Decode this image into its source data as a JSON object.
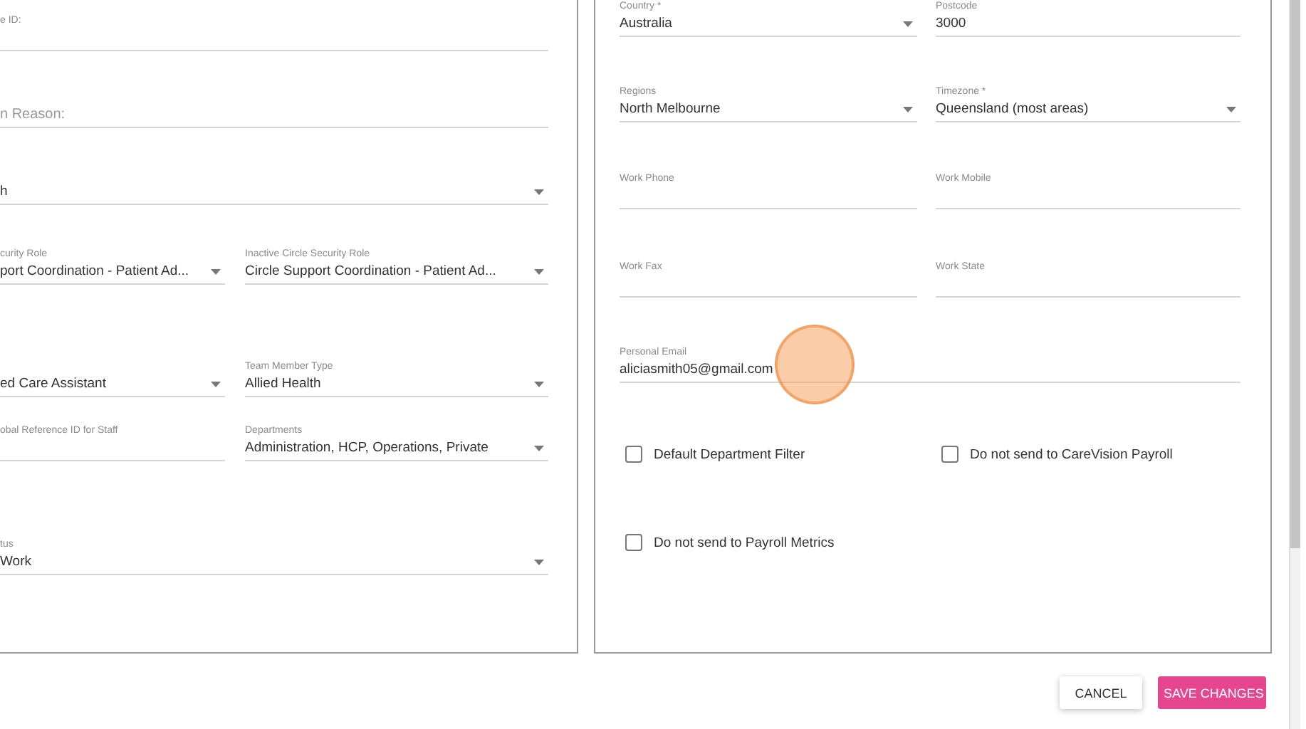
{
  "left_panel": {
    "rows": [
      {
        "fields": [
          {
            "kind": "text",
            "label": "e ID:"
          }
        ]
      },
      {
        "fields": [
          {
            "kind": "text",
            "placeholder": "n Reason:"
          }
        ]
      },
      {
        "fields": [
          {
            "kind": "select",
            "value": "h"
          }
        ]
      },
      {
        "fields": [
          {
            "kind": "select",
            "label": "curity Role",
            "value": "port Coordination - Patient Ad..."
          },
          {
            "kind": "select",
            "label": "Inactive Circle Security Role",
            "value": "Circle Support Coordination - Patient Ad..."
          }
        ]
      },
      {
        "fields": [
          {
            "kind": "select",
            "value": "ed Care Assistant"
          },
          {
            "kind": "select",
            "label": "Team Member Type",
            "value": "Allied Health"
          }
        ]
      },
      {
        "fields": [
          {
            "kind": "text",
            "label": "obal Reference ID for Staff"
          },
          {
            "kind": "select",
            "label": "Departments",
            "value": "Administration, HCP, Operations, Private"
          }
        ]
      },
      {
        "fields": [
          {
            "kind": "select",
            "label": "tus",
            "value": "Work"
          }
        ]
      }
    ]
  },
  "right_panel": {
    "rows": [
      {
        "fields": [
          {
            "kind": "select",
            "label": "Country *",
            "value": "Australia"
          },
          {
            "kind": "text",
            "label": "Postcode",
            "value": "3000"
          }
        ]
      },
      {
        "fields": [
          {
            "kind": "select",
            "label": "Regions",
            "value": "North Melbourne"
          },
          {
            "kind": "select",
            "label": "Timezone *",
            "value": "Queensland (most areas)"
          }
        ]
      },
      {
        "fields": [
          {
            "kind": "text",
            "label": "Work Phone"
          },
          {
            "kind": "text",
            "label": "Work Mobile"
          }
        ]
      },
      {
        "fields": [
          {
            "kind": "text",
            "label": "Work Fax"
          },
          {
            "kind": "text",
            "label": "Work State"
          }
        ]
      },
      {
        "fields": [
          {
            "kind": "text",
            "label": "Personal Email",
            "value": "aliciasmith05@gmail.com"
          }
        ]
      },
      {
        "checkboxes": [
          {
            "label": "Default Department Filter",
            "checked": false
          },
          {
            "label": "Do not send to CareVision Payroll",
            "checked": false
          }
        ]
      },
      {
        "checkboxes": [
          {
            "label": "Do not send to Payroll Metrics",
            "checked": false
          }
        ]
      }
    ]
  },
  "buttons": [
    {
      "kind": "secondary",
      "label": "CANCEL"
    },
    {
      "kind": "primary",
      "label": "SAVE CHANGES"
    }
  ]
}
